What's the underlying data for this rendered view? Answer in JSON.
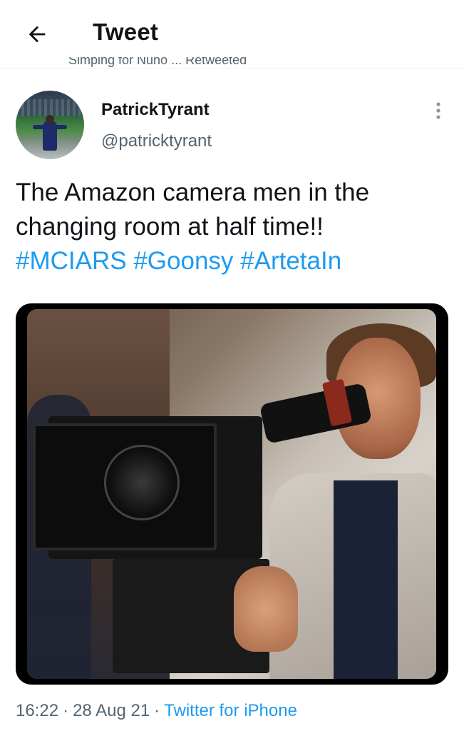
{
  "header": {
    "back_icon": "arrow-left-icon",
    "title": "Tweet"
  },
  "retweet_context": {
    "icon": "retweet-icon",
    "text": "Simping for Nuno ... Retweeted"
  },
  "tweet": {
    "author": {
      "display_name": "PatrickTyrant",
      "handle": "@patricktyrant",
      "avatar": "avatar"
    },
    "more_icon": "more-vertical-icon",
    "text_line1": "The Amazon camera men in the",
    "text_line2": "changing room at half time!!",
    "hashtags": [
      "#MCIARS",
      "#Goonsy",
      "#ArtetaIn"
    ],
    "media": {
      "type": "photo"
    },
    "time": "16:22",
    "date": "28 Aug 21",
    "source": "Twitter for iPhone"
  },
  "colors": {
    "accent": "#1d9bf0",
    "text_primary": "#0f1419",
    "text_secondary": "#536471",
    "background": "#ffffff"
  }
}
